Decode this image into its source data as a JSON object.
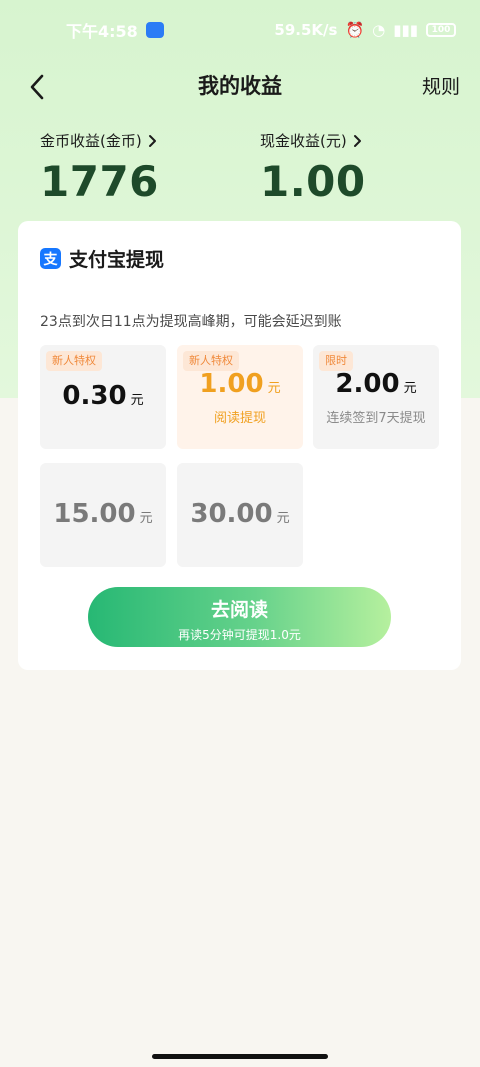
{
  "status_bar": {
    "time": "下午4:58",
    "net_speed": "59.5K/s",
    "battery": "100"
  },
  "nav": {
    "title": "我的收益",
    "rules": "规则"
  },
  "earnings": {
    "coin_label": "金币收益(金币)",
    "coin_value": "1776",
    "cash_label": "现金收益(元)",
    "cash_value": "1.00"
  },
  "withdraw": {
    "title": "支付宝提现",
    "icon_letter": "支",
    "notice": "23点到次日11点为提现高峰期，可能会延迟到账",
    "options": [
      {
        "tag": "新人特权",
        "amount": "0.30",
        "unit": "元",
        "sub": ""
      },
      {
        "tag": "新人特权",
        "amount": "1.00",
        "unit": "元",
        "sub": "阅读提现"
      },
      {
        "tag": "限时",
        "amount": "2.00",
        "unit": "元",
        "sub": "连续签到7天提现"
      },
      {
        "tag": "",
        "amount": "15.00",
        "unit": "元",
        "sub": ""
      },
      {
        "tag": "",
        "amount": "30.00",
        "unit": "元",
        "sub": ""
      }
    ],
    "cta_label": "去阅读",
    "cta_sub": "再读5分钟可提现1.0元"
  },
  "colors": {
    "header_bg": "#d7f4cf",
    "value_green": "#1e4a2a",
    "accent_orange": "#f0a020",
    "cta_start": "#27b874",
    "cta_end": "#b6f09e"
  }
}
